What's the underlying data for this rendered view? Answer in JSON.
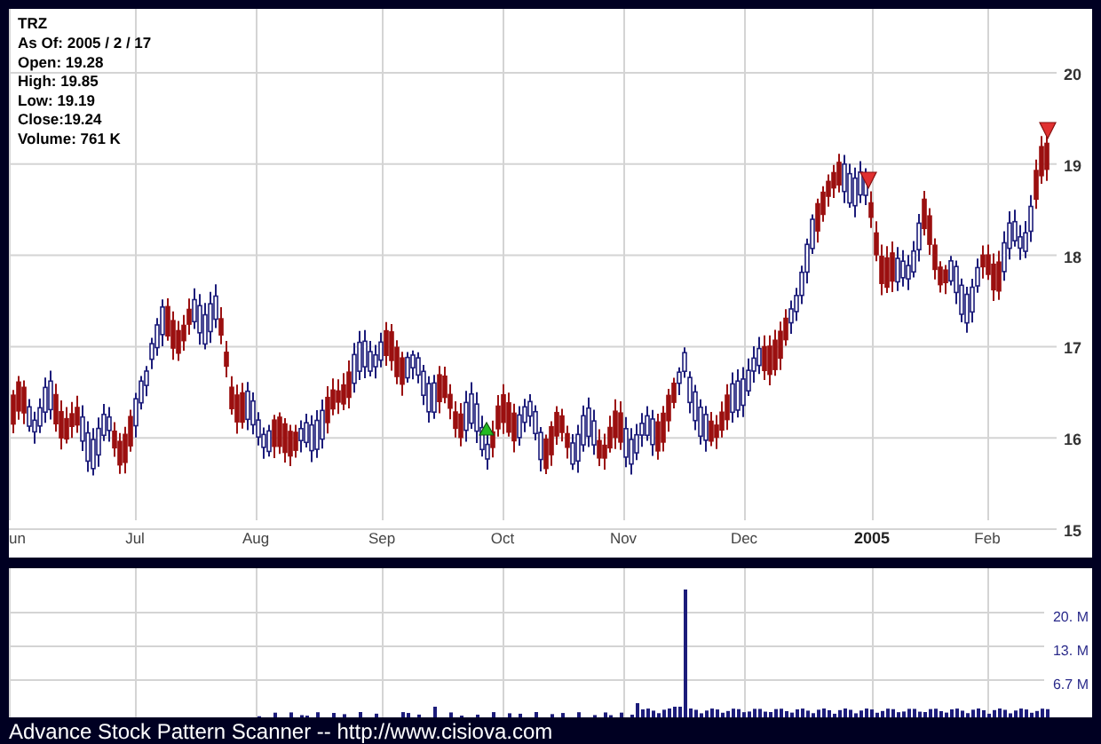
{
  "quote_info": {
    "symbol": "TRZ",
    "lines": [
      "As Of: 2005 / 2 / 17",
      "Open: 19.28",
      "High: 19.85",
      "Low: 19.19",
      "Close:19.24",
      "Volume: 761 K"
    ]
  },
  "price_axis": [
    "20",
    "19",
    "18",
    "17",
    "16",
    "15"
  ],
  "time_axis": [
    {
      "label": "un",
      "kind": "month"
    },
    {
      "label": "Jul",
      "kind": "month"
    },
    {
      "label": "Aug",
      "kind": "month"
    },
    {
      "label": "Sep",
      "kind": "month"
    },
    {
      "label": "Oct",
      "kind": "month"
    },
    {
      "label": "Nov",
      "kind": "month"
    },
    {
      "label": "Dec",
      "kind": "month"
    },
    {
      "label": "2005",
      "kind": "year"
    },
    {
      "label": "Feb",
      "kind": "month"
    }
  ],
  "signals": [
    {
      "kind": "buy"
    },
    {
      "kind": "sell"
    },
    {
      "kind": "sell"
    }
  ],
  "volume_axis": [
    "20. M",
    "13. M",
    "6.7 M"
  ],
  "footer": "Advance Stock Pattern Scanner -- http://www.cisiova.com"
}
